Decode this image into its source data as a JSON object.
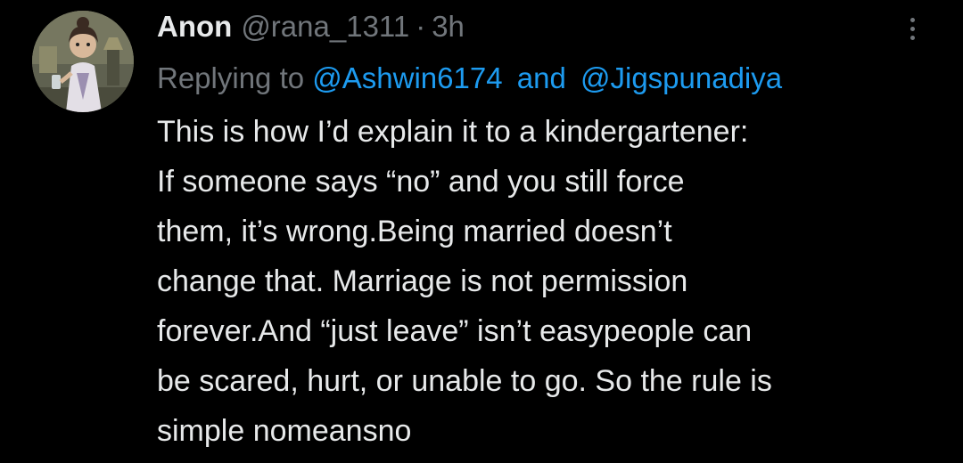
{
  "tweet": {
    "author": {
      "display_name": "Anon",
      "handle": "@rana_1311",
      "separator": "·",
      "time": "3h",
      "avatar_icon": "cartoon-avatar-icon"
    },
    "reply": {
      "prefix": "Replying to",
      "mention_1": "@Ashwin6174",
      "conjunction": "and",
      "mention_2": "@Jigspunadiya"
    },
    "body_lines": [
      "This is how I’d explain it to a kindergartener:",
      "If someone says “no” and you still force",
      "them, it’s wrong.Being married doesn’t",
      "change that. Marriage is not permission",
      "forever.And “just leave” isn’t easypeople can",
      "be scared, hurt, or unable to go. So the rule is",
      "simple nomeansno"
    ],
    "more_icon": "more-vertical-icon"
  },
  "colors": {
    "background": "#000000",
    "primary_text": "#e7e9ea",
    "secondary_text": "#71767b",
    "link": "#1d9bf0"
  }
}
